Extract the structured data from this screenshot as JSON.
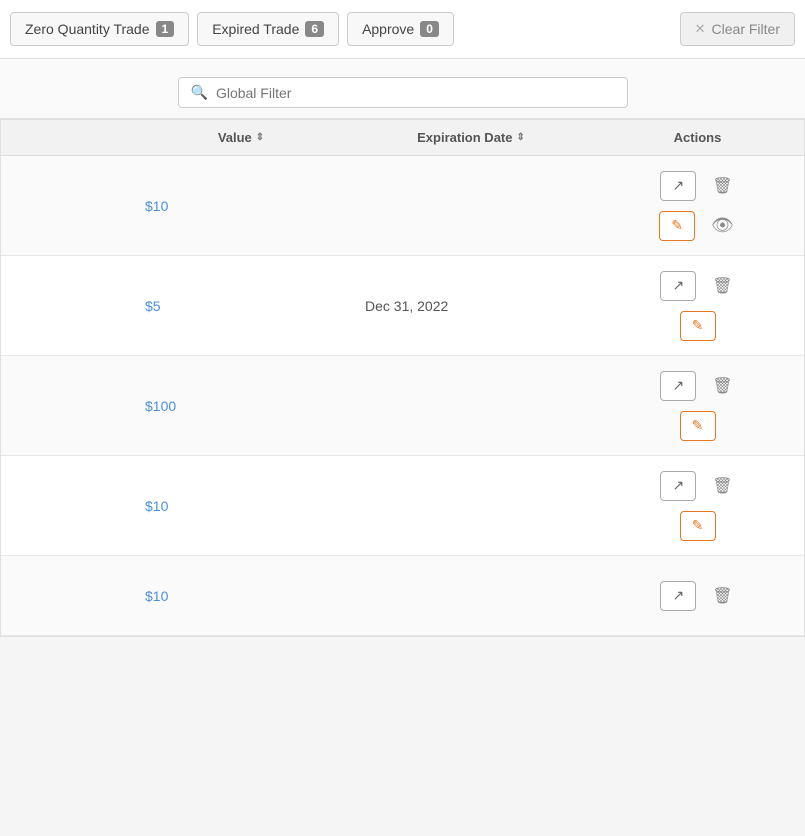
{
  "topbar": {
    "btn_zero_quantity": "Zero Quantity Trade",
    "badge_zero": "1",
    "btn_expired_trade": "Expired Trade",
    "badge_expired": "6",
    "btn_approve": "Approve",
    "badge_approve": "0",
    "btn_clear_filter": "Clear Filter"
  },
  "search": {
    "placeholder": "Global Filter"
  },
  "table": {
    "col_value": "Value",
    "col_expiration": "Expiration Date",
    "col_actions": "Actions",
    "rows": [
      {
        "id": 1,
        "value": "$10",
        "expiration": ""
      },
      {
        "id": 2,
        "value": "$5",
        "expiration": "Dec 31, 2022"
      },
      {
        "id": 3,
        "value": "$100",
        "expiration": ""
      },
      {
        "id": 4,
        "value": "$10",
        "expiration": ""
      },
      {
        "id": 5,
        "value": "$10",
        "expiration": ""
      }
    ]
  }
}
